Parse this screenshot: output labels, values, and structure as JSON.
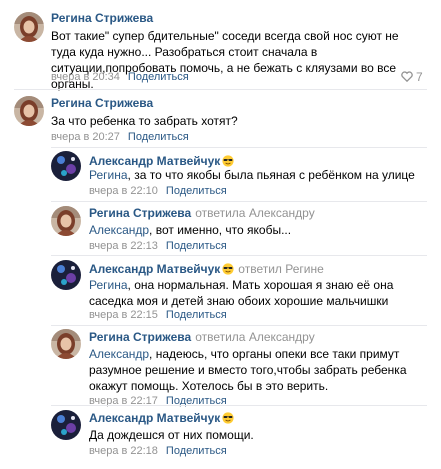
{
  "comments": [
    {
      "author": "Регина Стрижева",
      "text": "Вот такие\" супер бдительные\" соседи всегда свой нос суют не туда куда нужно... Разобраться стоит сначала в ситуации,попробовать помочь, а не бежать с кляузами во все органы.",
      "time": "вчера в 20:34",
      "share": "Поделиться",
      "likes": "7"
    },
    {
      "author": "Регина Стрижева",
      "text": "За что ребенка то забрать хотят?",
      "time": "вчера в 20:27",
      "share": "Поделиться"
    },
    {
      "author": "Александр Матвейчук",
      "addressee": "Регина",
      "text": ", за то что якобы была пьяная с ребёнком на улице",
      "time": "вчера в 22:10",
      "share": "Поделиться"
    },
    {
      "author": "Регина Стрижева",
      "replied": "ответила Александру",
      "addressee": "Александр",
      "text": ", вот именно, что якобы...",
      "time": "вчера в 22:13",
      "share": "Поделиться"
    },
    {
      "author": "Александр Матвейчук",
      "replied": "ответил Регине",
      "addressee": "Регина",
      "text": ", она нормальная. Мать хорошая я знаю её она саседка моя и детей знаю обоих хорошие мальчишки",
      "time": "вчера в 22:15",
      "share": "Поделиться"
    },
    {
      "author": "Регина Стрижева",
      "replied": "ответила Александру",
      "addressee": "Александр",
      "text": ", надеюсь, что органы опеки все таки примут разумное решение и вместо того,чтобы забрать ребенка окажут помощь. Хотелось бы в это верить.",
      "time": "вчера в 22:17",
      "share": "Поделиться"
    },
    {
      "author": "Александр Матвейчук",
      "text": "Да дождешся от них помощи.",
      "time": "вчера в 22:18",
      "share": "Поделиться"
    }
  ],
  "icons": {
    "like": "heart-icon",
    "emoji": "sunglasses-emoji-icon"
  },
  "colors": {
    "link": "#2a5885",
    "muted": "#939393",
    "separator": "#e7e8ec"
  }
}
